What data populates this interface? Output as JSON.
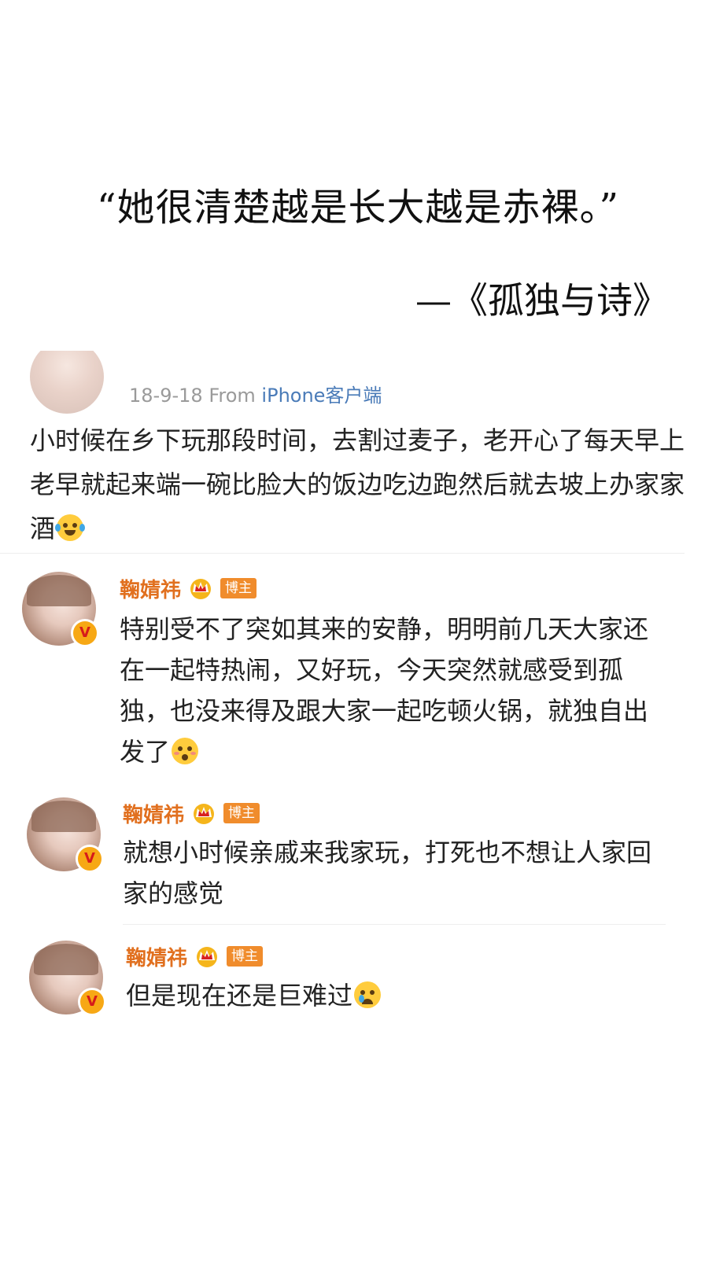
{
  "quote": {
    "text": "“她很清楚越是长大越是赤裸。”",
    "source": "—《孤独与诗》"
  },
  "post": {
    "date": "18-9-18",
    "from_label": "From",
    "client": "iPhone客户端",
    "text": "小时候在乡下玩那段时间，去割过麦子，老开心了每天早上老早就起来端一碗比脸大的饭边吃边跑然后就去坡上办家家酒",
    "emoji": "laughing-tears-emoji"
  },
  "replies": [
    {
      "name": "鞠婧祎",
      "badge": "博主",
      "verified_mark": "V",
      "text": "特别受不了突如其来的安静，明明前几天大家还在一起特热闹，又好玩，今天突然就感受到孤独，也没来得及跟大家一起吃顿火锅，就独自出发了",
      "emoji": "flushed-face-emoji"
    },
    {
      "name": "鞠婧祎",
      "badge": "博主",
      "verified_mark": "V",
      "text": "就想小时候亲戚来我家玩，打死也不想让人家回家的感觉",
      "emoji": ""
    },
    {
      "name": "鞠婧祎",
      "badge": "博主",
      "verified_mark": "V",
      "text": "但是现在还是巨难过",
      "emoji": "crying-face-emoji"
    }
  ],
  "colors": {
    "name": "#e1701f",
    "badge": "#f08c2c",
    "client_link": "#4a7bb8",
    "meta_gray": "#9a9a9a",
    "verified_badge": "#f7a815"
  }
}
